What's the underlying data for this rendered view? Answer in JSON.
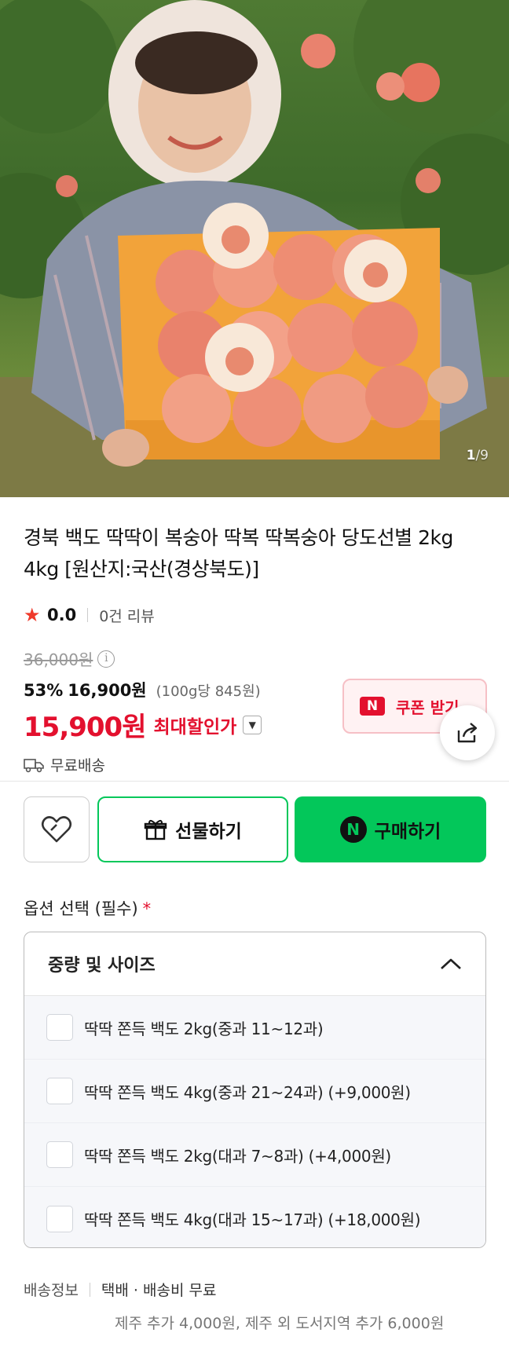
{
  "gallery": {
    "current": "1",
    "separator": "/",
    "total": "9"
  },
  "product": {
    "title": "경북 백도 딱딱이 복숭아 딱복 딱복숭아 당도선별 2kg 4kg [원산지:국산(경상북도)]",
    "rating": "0.0",
    "review_count": "0건 리뷰"
  },
  "price": {
    "original": "36,000원",
    "discount_rate": "53%",
    "sale": "16,900원",
    "unit": "(100g당 845원)",
    "final": "15,900원",
    "max_discount_label": "최대할인가",
    "coupon_label": "쿠폰 받기",
    "coupon_badge": "N"
  },
  "shipping": {
    "label": "무료배송"
  },
  "actions": {
    "gift_label": "선물하기",
    "buy_label": "구매하기",
    "buy_badge": "N"
  },
  "options": {
    "heading": "옵션 선택 (필수)",
    "required_mark": "*",
    "group_title": "중량 및 사이즈",
    "items": [
      {
        "label": "딱딱 쫀득 백도 2kg(중과 11~12과)"
      },
      {
        "label": "딱딱 쫀득 백도 4kg(중과 21~24과) (+9,000원)"
      },
      {
        "label": "딱딱 쫀득 백도 2kg(대과 7~8과) (+4,000원)"
      },
      {
        "label": "딱딱 쫀득 백도 4kg(대과 15~17과) (+18,000원)"
      }
    ]
  },
  "delivery": {
    "key": "배송정보",
    "value": "택배 · 배송비 무료",
    "note": "제주 추가 4,000원, 제주 외 도서지역 추가 6,000원"
  },
  "colors": {
    "sale_red": "#e3102e",
    "naver_green": "#03c75a",
    "star": "#ef3a2b"
  }
}
